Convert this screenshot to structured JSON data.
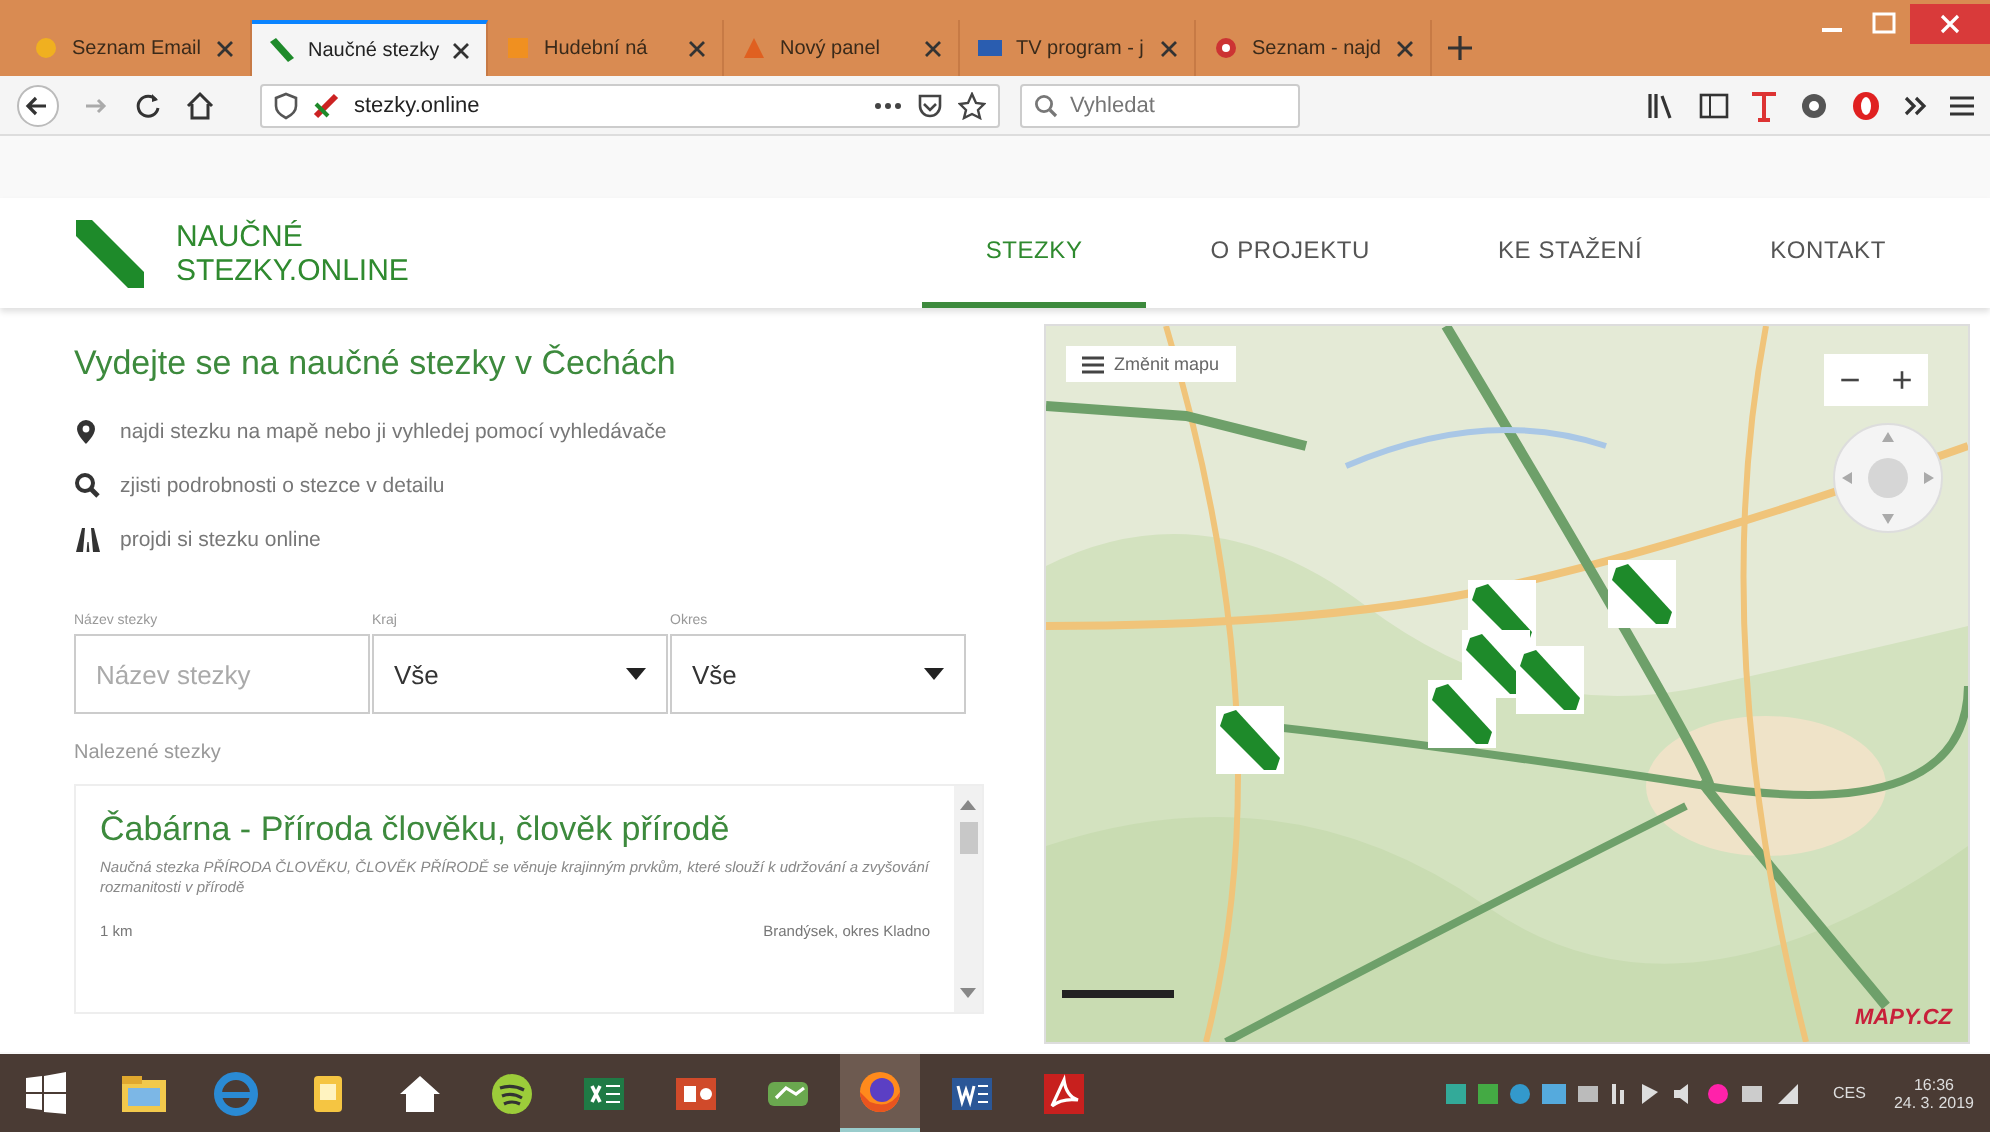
{
  "browser": {
    "tabs": [
      {
        "title": "Seznam Email",
        "selected": false,
        "kind": "mail"
      },
      {
        "title": "Naučné stezky",
        "selected": true,
        "kind": "site"
      },
      {
        "title": "Hudební ná",
        "selected": false,
        "kind": "shop"
      },
      {
        "title": "Nový panel",
        "selected": false,
        "kind": "new"
      },
      {
        "title": "TV program - j",
        "selected": false,
        "kind": "tv"
      },
      {
        "title": "Seznam - najd",
        "selected": false,
        "kind": "search"
      }
    ],
    "url": "stezky.online",
    "search_placeholder": "Vyhledat"
  },
  "site": {
    "logo": [
      "NAUČNÉ",
      "STEZKY.ONLINE"
    ],
    "nav": [
      {
        "label": "STEZKY",
        "selected": true
      },
      {
        "label": "O PROJEKTU",
        "selected": false
      },
      {
        "label": "KE STAŽENÍ",
        "selected": false
      },
      {
        "label": "KONTAKT",
        "selected": false
      }
    ],
    "heading": "Vydejte se na naučné stezky v Čechách",
    "features": [
      {
        "kind": "pin",
        "text": "najdi stezku na mapě nebo ji vyhledej pomocí vyhledávače"
      },
      {
        "kind": "search",
        "text": "zjisti podrobnosti o stezce v detailu"
      },
      {
        "kind": "road",
        "text": "projdi si stezku online"
      }
    ],
    "filters": [
      {
        "kind": "text",
        "label": "Název stezky",
        "placeholder": "Název stezky"
      },
      {
        "kind": "select",
        "label": "Kraj",
        "value": "Vše"
      },
      {
        "kind": "select",
        "label": "Okres",
        "value": "Vše"
      }
    ],
    "results_label": "Nalezené stezky",
    "results": [
      {
        "title": "Čabárna - Příroda člověku, člověk přírodě",
        "description": "Naučná stezka PŘÍRODA ČLOVĚKU, ČLOVĚK PŘÍRODĚ se věnuje krajinným prvkům, které slouží k udržování a zvyšování rozmanitosti v přírodě",
        "length": "1 km",
        "place": "Brandýsek, okres Kladno"
      }
    ],
    "map": {
      "layer_button": "Změnit mapu",
      "zoom_out": "−",
      "zoom_in": "+",
      "logo": "MAPY.CZ"
    }
  },
  "taskbar": {
    "apps": [
      {
        "kind": "files",
        "selected": false
      },
      {
        "kind": "ie",
        "selected": false
      },
      {
        "kind": "notes",
        "selected": false
      },
      {
        "kind": "home",
        "selected": false
      },
      {
        "kind": "music",
        "selected": false
      },
      {
        "kind": "sheet",
        "selected": false
      },
      {
        "kind": "slides",
        "selected": false
      },
      {
        "kind": "game",
        "selected": false
      },
      {
        "kind": "firefox",
        "selected": true
      },
      {
        "kind": "word",
        "selected": false
      },
      {
        "kind": "pdf",
        "selected": false
      }
    ],
    "language": "CES",
    "time": "16:36",
    "date": "24. 3. 2019"
  }
}
